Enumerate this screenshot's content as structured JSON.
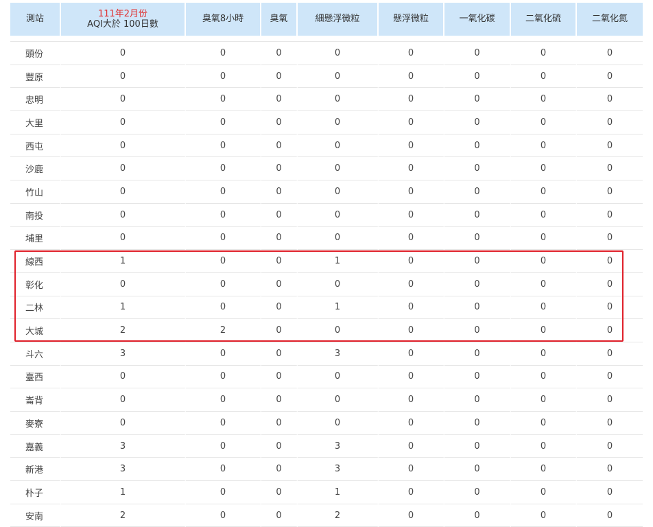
{
  "table": {
    "month_label": "111年2月份",
    "headers": [
      "測站",
      "AQI大於 100日數",
      "臭氧8小時",
      "臭氧",
      "細懸浮微粒",
      "懸浮微粒",
      "一氧化碳",
      "二氧化硫",
      "二氧化氮"
    ],
    "rows": [
      [
        "頭份",
        "0",
        "0",
        "0",
        "0",
        "0",
        "0",
        "0",
        "0"
      ],
      [
        "豐原",
        "0",
        "0",
        "0",
        "0",
        "0",
        "0",
        "0",
        "0"
      ],
      [
        "忠明",
        "0",
        "0",
        "0",
        "0",
        "0",
        "0",
        "0",
        "0"
      ],
      [
        "大里",
        "0",
        "0",
        "0",
        "0",
        "0",
        "0",
        "0",
        "0"
      ],
      [
        "西屯",
        "0",
        "0",
        "0",
        "0",
        "0",
        "0",
        "0",
        "0"
      ],
      [
        "沙鹿",
        "0",
        "0",
        "0",
        "0",
        "0",
        "0",
        "0",
        "0"
      ],
      [
        "竹山",
        "0",
        "0",
        "0",
        "0",
        "0",
        "0",
        "0",
        "0"
      ],
      [
        "南投",
        "0",
        "0",
        "0",
        "0",
        "0",
        "0",
        "0",
        "0"
      ],
      [
        "埔里",
        "0",
        "0",
        "0",
        "0",
        "0",
        "0",
        "0",
        "0"
      ],
      [
        "線西",
        "1",
        "0",
        "0",
        "1",
        "0",
        "0",
        "0",
        "0"
      ],
      [
        "彰化",
        "0",
        "0",
        "0",
        "0",
        "0",
        "0",
        "0",
        "0"
      ],
      [
        "二林",
        "1",
        "0",
        "0",
        "1",
        "0",
        "0",
        "0",
        "0"
      ],
      [
        "大城",
        "2",
        "2",
        "0",
        "0",
        "0",
        "0",
        "0",
        "0"
      ],
      [
        "斗六",
        "3",
        "0",
        "0",
        "3",
        "0",
        "0",
        "0",
        "0"
      ],
      [
        "臺西",
        "0",
        "0",
        "0",
        "0",
        "0",
        "0",
        "0",
        "0"
      ],
      [
        "崙背",
        "0",
        "0",
        "0",
        "0",
        "0",
        "0",
        "0",
        "0"
      ],
      [
        "麥寮",
        "0",
        "0",
        "0",
        "0",
        "0",
        "0",
        "0",
        "0"
      ],
      [
        "嘉義",
        "3",
        "0",
        "0",
        "3",
        "0",
        "0",
        "0",
        "0"
      ],
      [
        "新港",
        "3",
        "0",
        "0",
        "3",
        "0",
        "0",
        "0",
        "0"
      ],
      [
        "朴子",
        "1",
        "0",
        "0",
        "1",
        "0",
        "0",
        "0",
        "0"
      ],
      [
        "安南",
        "2",
        "0",
        "0",
        "2",
        "0",
        "0",
        "0",
        "0"
      ]
    ]
  },
  "colors": {
    "header_bg": "#cfe6f9",
    "highlight_border": "#e0202a",
    "month_label": "#e03030"
  }
}
